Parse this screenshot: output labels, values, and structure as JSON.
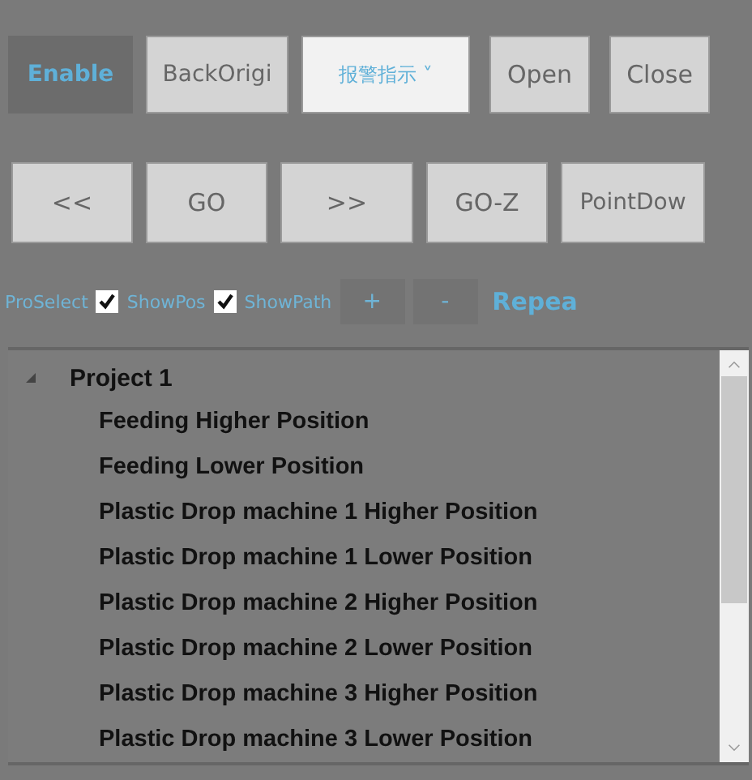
{
  "toolbar_1": {
    "status": "Enable",
    "buttons": [
      {
        "label": "BackOrigi"
      }
    ],
    "dropdown": {
      "value": "报警指示",
      "arrow": "˅"
    },
    "buttons_2": [
      {
        "label": "Open"
      },
      {
        "label": "Close"
      }
    ]
  },
  "toolbar_2": {
    "buttons": [
      {
        "label": "<<"
      },
      {
        "label": "GO"
      },
      {
        "label": ">>"
      },
      {
        "label": "GO-Z"
      },
      {
        "label": "PointDow"
      }
    ]
  },
  "options": {
    "label": "ProSelect",
    "checkboxes": [
      {
        "label": "ShowPos",
        "checked": true
      },
      {
        "label": "ShowPath",
        "checked": true
      }
    ],
    "buttons": [
      {
        "label": "+"
      },
      {
        "label": "-"
      }
    ],
    "link": "Repea"
  },
  "tree": {
    "items": [
      {
        "label": "Project 1",
        "expanded": true,
        "children": [
          {
            "label": "Feeding Higher Position"
          },
          {
            "label": "Feeding Lower Position"
          },
          {
            "label": "Plastic Drop machine 1 Higher Position"
          },
          {
            "label": "Plastic Drop machine 1 Lower Position"
          },
          {
            "label": "Plastic Drop machine 2 Higher Position"
          },
          {
            "label": "Plastic Drop machine 2 Lower Position"
          },
          {
            "label": "Plastic Drop machine 3 Higher Position"
          },
          {
            "label": "Plastic Drop machine 3 Lower Position"
          }
        ]
      }
    ]
  }
}
